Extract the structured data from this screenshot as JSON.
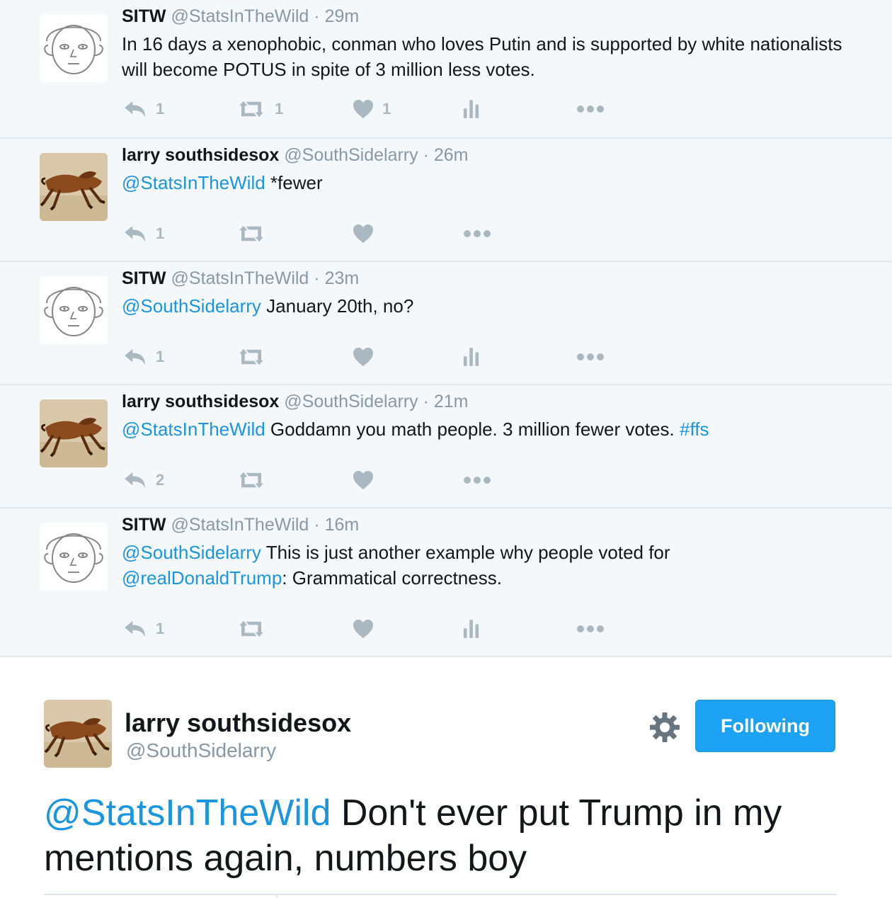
{
  "colors": {
    "link": "#1b95e0",
    "follow_button": "#1da1f2",
    "icon": "#aab8c2",
    "thread_bg": "#f5f8fa"
  },
  "thread": [
    {
      "name": "SITW",
      "handle": "@StatsInTheWild",
      "separator": "·",
      "time": "29m",
      "avatar_icon": "face-sketch-avatar",
      "text": {
        "mention": "",
        "body": "In 16 days a xenophobic, conman who loves Putin and is supported by white nationalists will become POTUS in spite of 3 million less votes."
      },
      "counts": {
        "reply": "1",
        "retweet": "1",
        "like": "1"
      }
    },
    {
      "name": "larry southsidesox",
      "handle": "@SouthSidelarry",
      "separator": "·",
      "time": "26m",
      "avatar_icon": "horse-photo-avatar",
      "text": {
        "mention": "@StatsInTheWild",
        "body": " *fewer"
      },
      "counts": {
        "reply": "1",
        "retweet": "",
        "like": ""
      }
    },
    {
      "name": "SITW",
      "handle": "@StatsInTheWild",
      "separator": "·",
      "time": "23m",
      "avatar_icon": "face-sketch-avatar",
      "text": {
        "mention": "@SouthSidelarry",
        "body": " January 20th, no?"
      },
      "counts": {
        "reply": "1",
        "retweet": "",
        "like": ""
      }
    },
    {
      "name": "larry southsidesox",
      "handle": "@SouthSidelarry",
      "separator": "·",
      "time": "21m",
      "avatar_icon": "horse-photo-avatar",
      "text": {
        "mention": "@StatsInTheWild",
        "body": " Goddamn you math people. 3 million fewer votes. ",
        "hashtag": "#ffs"
      },
      "counts": {
        "reply": "2",
        "retweet": "",
        "like": ""
      }
    },
    {
      "name": "SITW",
      "handle": "@StatsInTheWild",
      "separator": "·",
      "time": "16m",
      "avatar_icon": "face-sketch-avatar",
      "text": {
        "mention": "@SouthSidelarry",
        "body": " This is just another example why people voted for ",
        "mention2": "@realDonaldTrump",
        "body2": ": Grammatical correctness."
      },
      "counts": {
        "reply": "1",
        "retweet": "",
        "like": ""
      }
    }
  ],
  "focus": {
    "name": "larry southsidesox",
    "handle": "@SouthSidelarry",
    "follow_label": "Following",
    "mention": "@StatsInTheWild",
    "text": " Don't ever put Trump in my mentions again, numbers boy"
  }
}
